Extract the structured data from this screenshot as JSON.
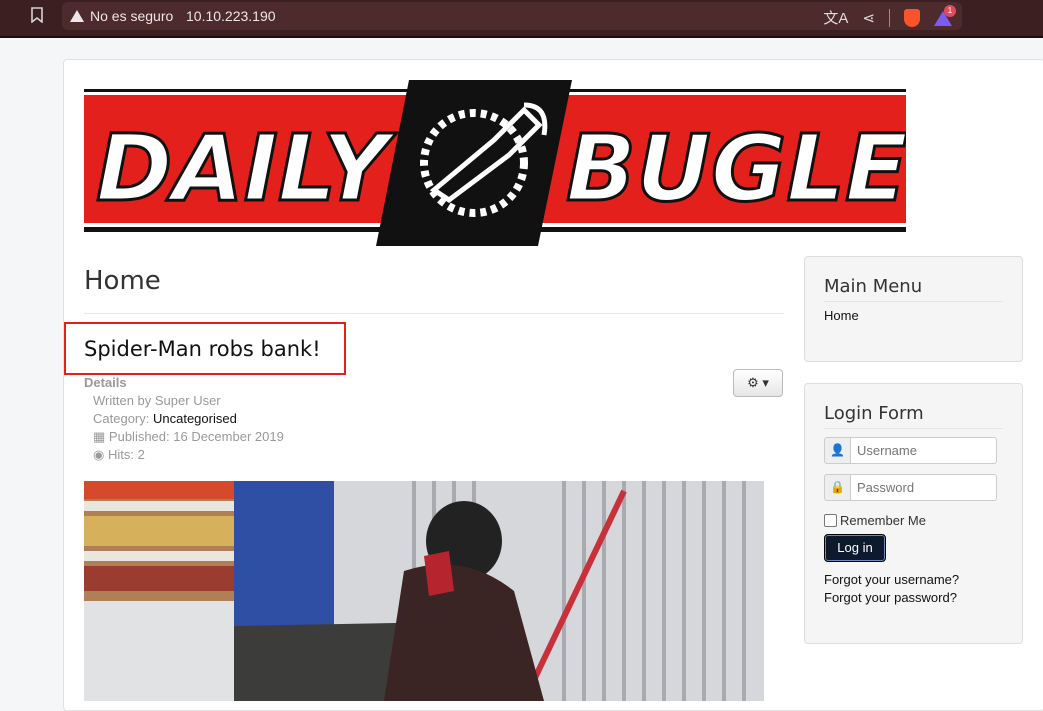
{
  "browser": {
    "security_label": "No es seguro",
    "url": "10.10.223.190",
    "notification_count": "1"
  },
  "site": {
    "logo_word_left": "DAILY",
    "logo_word_right": "BUGLE",
    "brand_red": "#e3201c"
  },
  "main": {
    "page_title": "Home",
    "article_title": "Spider-Man robs bank!",
    "details_label": "Details",
    "written_by": "Written by Super User",
    "category_prefix": "Category: ",
    "category": "Uncategorised",
    "published": "Published: 16 December 2019",
    "hits": "Hits: 2"
  },
  "sidebar": {
    "main_menu": {
      "title": "Main Menu",
      "items": [
        "Home"
      ]
    },
    "login": {
      "title": "Login Form",
      "username_placeholder": "Username",
      "password_placeholder": "Password",
      "remember_label": "Remember Me",
      "login_button": "Log in",
      "forgot_username": "Forgot your username?",
      "forgot_password": "Forgot your password?"
    }
  }
}
